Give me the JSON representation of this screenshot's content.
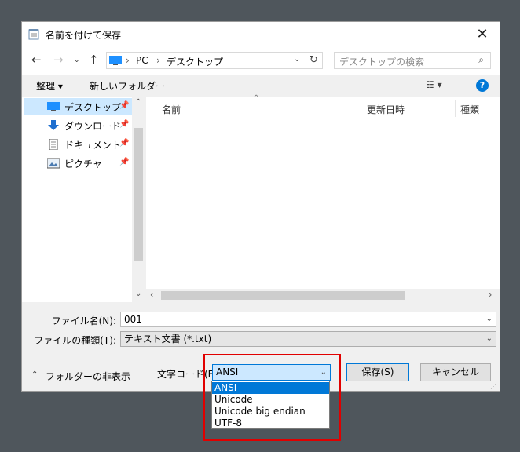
{
  "window": {
    "title": "名前を付けて保存"
  },
  "nav": {
    "path_root": "PC",
    "path_current": "デスクトップ",
    "search_placeholder": "デスクトップの検索"
  },
  "toolbar": {
    "organize": "整理 ▾",
    "new_folder": "新しいフォルダー"
  },
  "sidebar": {
    "items": [
      {
        "label": "デスクトップ",
        "icon": "desktop-icon"
      },
      {
        "label": "ダウンロード",
        "icon": "download-icon"
      },
      {
        "label": "ドキュメント",
        "icon": "document-icon"
      },
      {
        "label": "ピクチャ",
        "icon": "pictures-icon"
      }
    ]
  },
  "columns": {
    "name": "名前",
    "date": "更新日時",
    "type": "種類"
  },
  "form": {
    "filename_label": "ファイル名(N):",
    "filename_value": "001",
    "filetype_label": "ファイルの種類(T):",
    "filetype_value": "テキスト文書 (*.txt)",
    "encoding_label": "文字コード(E):",
    "encoding_value": "ANSI",
    "hide_folders": "フォルダーの非表示",
    "save": "保存(S)",
    "cancel": "キャンセル"
  },
  "encoding_options": [
    "ANSI",
    "Unicode",
    "Unicode big endian",
    "UTF-8"
  ],
  "colors": {
    "accent": "#0078d7",
    "highlight_box": "#e10000",
    "selected_nav": "#cce8ff"
  }
}
